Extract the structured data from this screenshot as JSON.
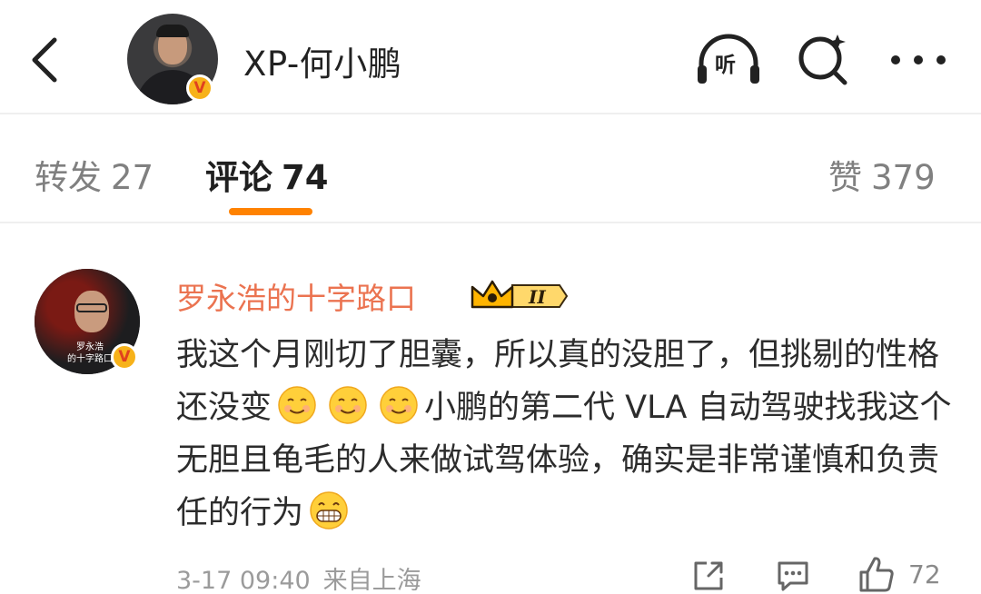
{
  "header": {
    "author_name": "XP-何小鹏",
    "verified_mark": "V",
    "listen_label": "听"
  },
  "tabs": {
    "repost": {
      "label": "转发",
      "count": "27"
    },
    "comments": {
      "label": "评论",
      "count": "74"
    },
    "likes": {
      "label": "赞",
      "count": "379"
    }
  },
  "comment": {
    "user_name": "罗永浩的十字路口",
    "avatar_caption": "罗永浩\n的十字路口",
    "verified_mark": "V",
    "level_badge": "II",
    "text_part1": "我这个月刚切了胆囊，所以真的没胆了，但挑剔的性格还没变",
    "text_part2": "小鹏的第二代 VLA 自动驾驶找我这个无胆且龟毛的人来做试驾体验，确实是非常谨慎和负责任的行为",
    "emojis": [
      "smile-emoji",
      "smile-emoji",
      "smile-emoji",
      "grin-emoji"
    ],
    "date": "3-17 09:40",
    "source": "来自上海",
    "like_count": "72"
  },
  "colors": {
    "accent": "#ff8200",
    "username": "#eb7350",
    "verified": "#f7b21a"
  }
}
